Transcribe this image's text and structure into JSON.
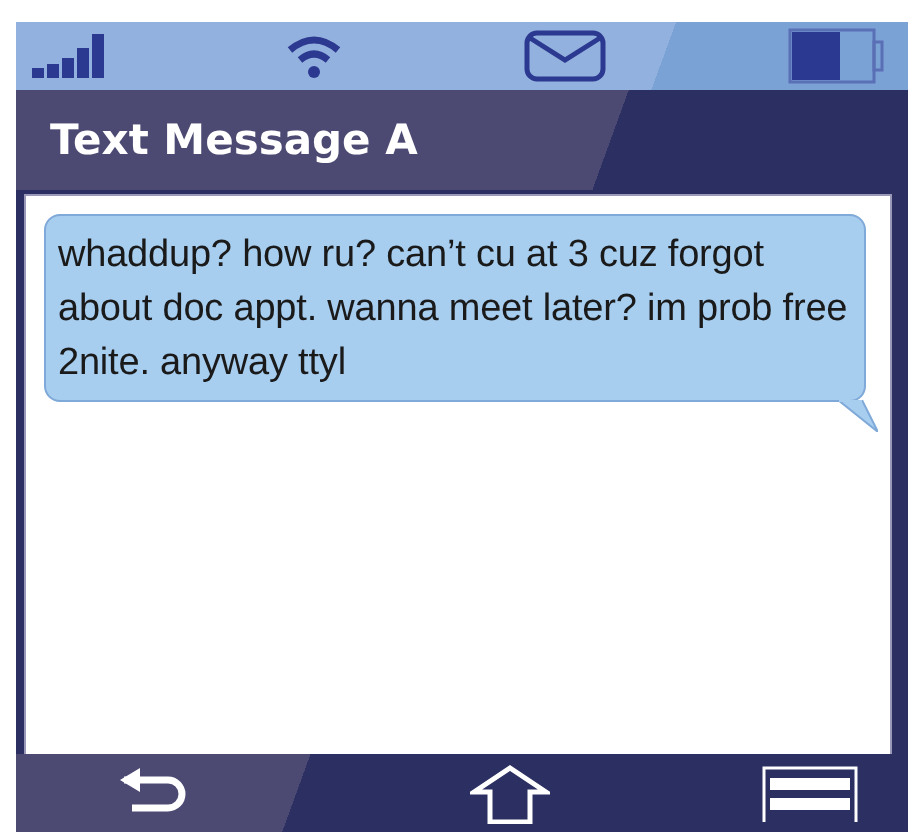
{
  "title": "Text Message A",
  "message": {
    "text": "whaddup? how ru? can’t cu at 3 cuz forgot about doc appt. wanna meet later? im prob free 2nite. anyway ttyl"
  }
}
